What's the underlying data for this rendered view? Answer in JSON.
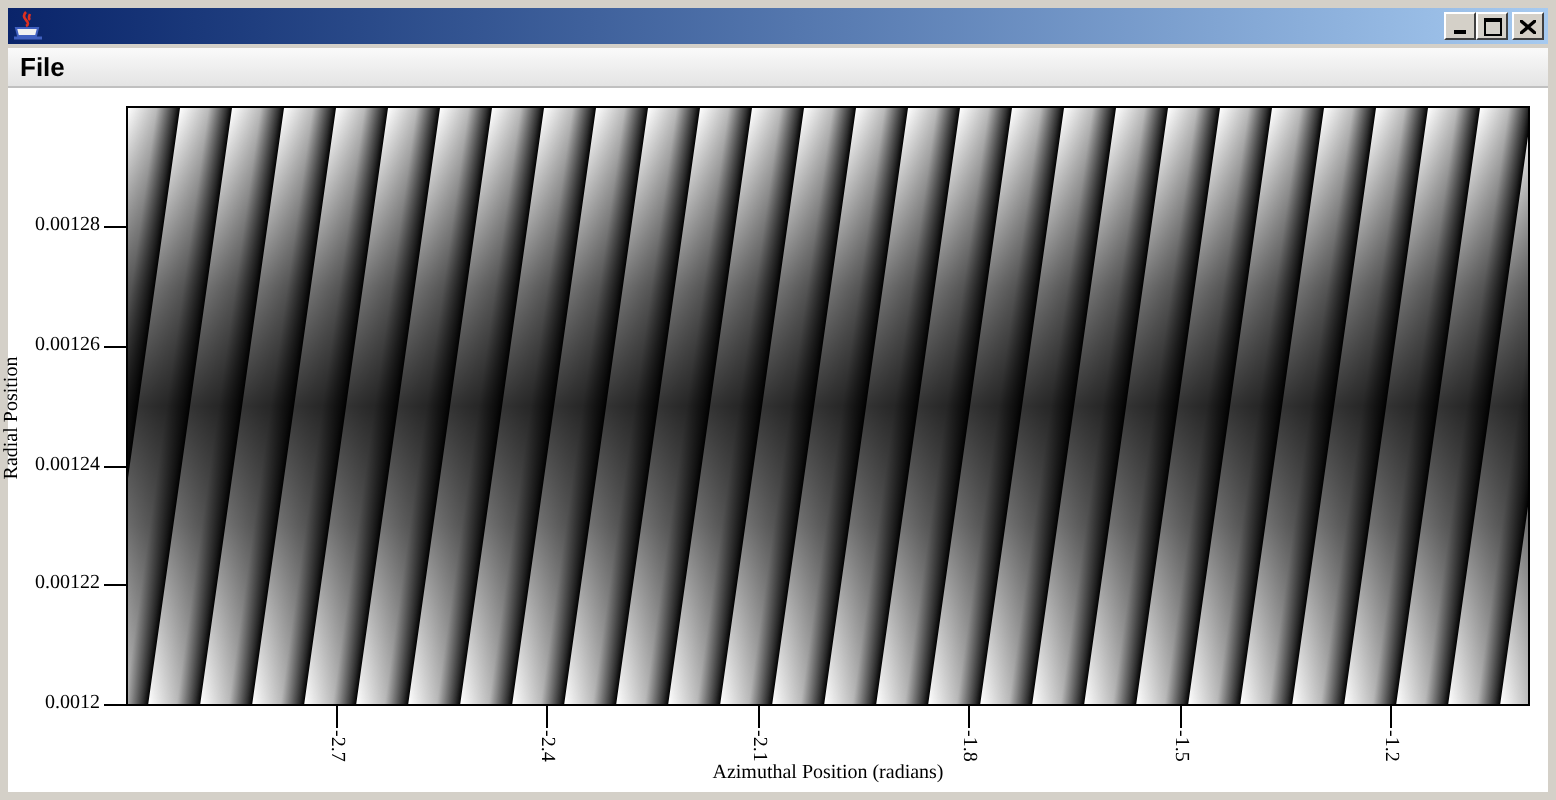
{
  "menu": [
    {
      "label": "File"
    }
  ],
  "plot": {
    "ylabel": "Radial Position",
    "xlabel": "Azimuthal Position (radians)",
    "yticks": [
      "0.00128",
      "0.00126",
      "0.00124",
      "0.00122",
      "0.0012"
    ],
    "xticks": [
      "-2.7",
      "-2.4",
      "-2.1",
      "-1.8",
      "-1.5",
      "-1.2"
    ]
  }
}
